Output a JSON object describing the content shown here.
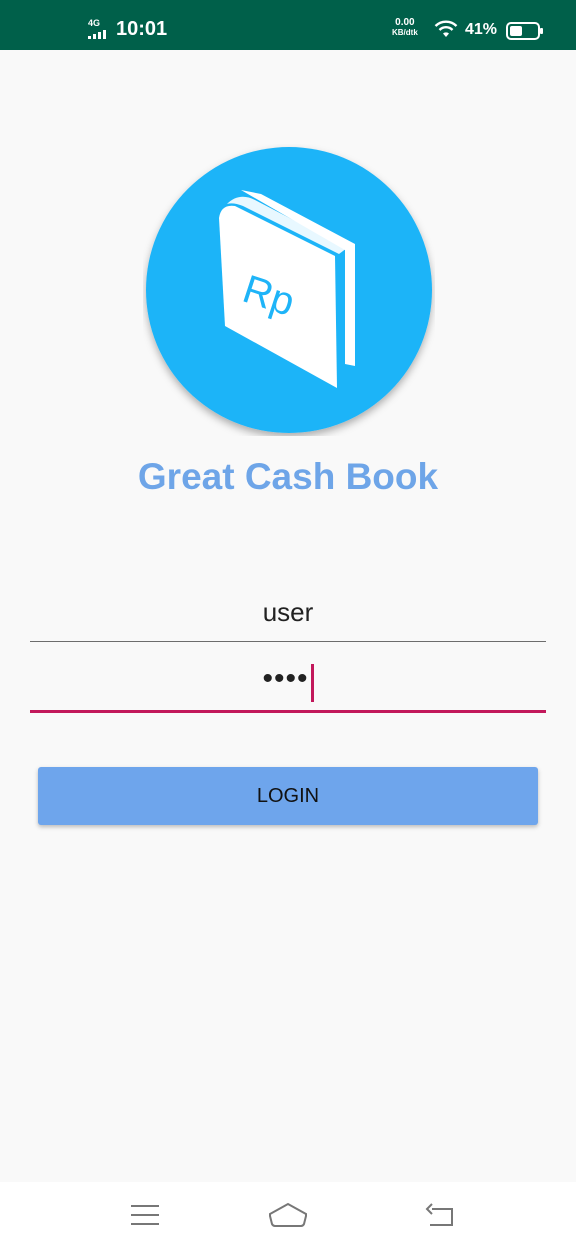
{
  "status_bar": {
    "network": "4G",
    "time": "10:01",
    "speed_value": "0.00",
    "speed_unit": "KB/dtk",
    "battery_percent": "41%"
  },
  "app": {
    "logo_text": "Rp",
    "title": "Great Cash Book"
  },
  "form": {
    "username_value": "user",
    "password_value": "••••",
    "login_label": "LOGIN"
  },
  "colors": {
    "status_bar": "#00604a",
    "accent": "#6ea5e8",
    "logo_circle": "#1eb4f8",
    "focus_underline": "#c2185b"
  }
}
